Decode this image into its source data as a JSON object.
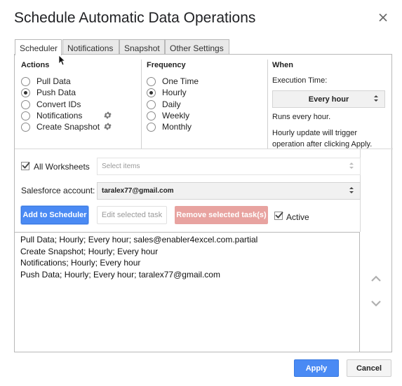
{
  "dialog": {
    "title": "Schedule Automatic Data Operations"
  },
  "tabs": [
    {
      "label": "Scheduler"
    },
    {
      "label": "Notifications"
    },
    {
      "label": "Snapshot"
    },
    {
      "label": "Other Settings"
    }
  ],
  "actions": {
    "title": "Actions",
    "items": [
      "Pull Data",
      "Push Data",
      "Convert IDs",
      "Notifications",
      "Create Snapshot"
    ],
    "selected": "Push Data"
  },
  "frequency": {
    "title": "Frequency",
    "items": [
      "One Time",
      "Hourly",
      "Daily",
      "Weekly",
      "Monthly"
    ],
    "selected": "Hourly"
  },
  "when": {
    "title": "When",
    "execution_label": "Execution Time:",
    "execution_value": "Every hour",
    "info1": "Runs every hour.",
    "info2_line1": "Hourly update will trigger",
    "info2_line2": "operation after clicking Apply."
  },
  "worksheets": {
    "label": "All Worksheets",
    "checked": true,
    "placeholder": "Select items"
  },
  "salesforce": {
    "label": "Salesforce account:",
    "value": "taralex77@gmail.com"
  },
  "buttons": {
    "add": "Add to Scheduler",
    "edit": "Edit selected task",
    "remove": "Remove selected task(s)",
    "active_label": "Active",
    "apply": "Apply",
    "cancel": "Cancel"
  },
  "tasks": [
    "Pull Data; Hourly; Every hour; sales@enabler4excel.com.partial",
    "Create Snapshot; Hourly; Every hour",
    "Notifications; Hourly; Every hour",
    "Push Data; Hourly; Every hour; taralex77@gmail.com"
  ],
  "colors": {
    "primary": "#4a8af4",
    "danger_disabled": "#e8a3a0"
  }
}
